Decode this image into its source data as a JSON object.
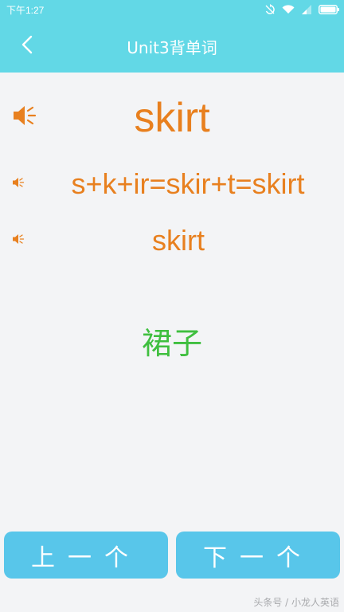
{
  "status_bar": {
    "time": "下午1:27",
    "icons": [
      "sync-icon",
      "wifi-icon",
      "signal-icon",
      "battery-icon"
    ]
  },
  "nav": {
    "title": "Unit3背单词",
    "back_icon": "chevron-left-icon"
  },
  "card": {
    "word": "skirt",
    "split": "s+k+ir=skir+t=skirt",
    "repeat": "skirt",
    "meaning": "裙子",
    "speaker_icon": "speaker-icon"
  },
  "buttons": {
    "prev_label": "上一个",
    "next_label": "下一个"
  },
  "watermark": "头条号 / 小龙人英语",
  "colors": {
    "header": "#62d8e6",
    "word": "#e8801f",
    "meaning": "#3fbf3f",
    "button": "#58c6ea",
    "background": "#f3f4f6"
  }
}
